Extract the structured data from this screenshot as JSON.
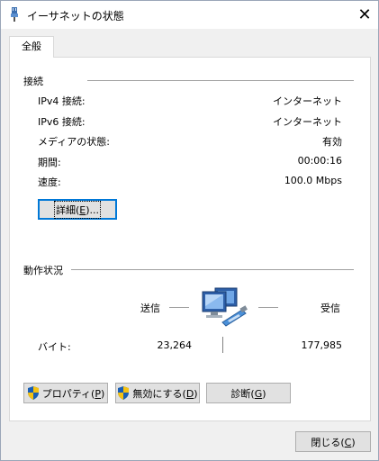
{
  "window": {
    "title": "イーサネットの状態",
    "close_symbol": "✕"
  },
  "tabs": [
    {
      "label": "全般"
    }
  ],
  "connection": {
    "section_title": "接続",
    "rows": [
      {
        "label": "IPv4 接続:",
        "value": "インターネット"
      },
      {
        "label": "IPv6 接続:",
        "value": "インターネット"
      },
      {
        "label": "メディアの状態:",
        "value": "有効"
      },
      {
        "label": "期間:",
        "value": "00:00:16"
      },
      {
        "label": "速度:",
        "value": "100.0 Mbps"
      }
    ],
    "details_button": {
      "text": "詳細(",
      "key": "E",
      "suffix": ")..."
    }
  },
  "activity": {
    "section_title": "動作状況",
    "sent_label": "送信",
    "received_label": "受信",
    "bytes_label": "バイト:",
    "sent_value": "23,264",
    "received_value": "177,985"
  },
  "buttons": {
    "properties": {
      "text": "プロパティ(",
      "key": "P",
      "suffix": ")"
    },
    "disable": {
      "text": "無効にする(",
      "key": "D",
      "suffix": ")"
    },
    "diagnose": {
      "text": "診断(",
      "key": "G",
      "suffix": ")"
    },
    "close": {
      "text": "閉じる(",
      "key": "C",
      "suffix": ")"
    }
  },
  "colors": {
    "accent": "#0078d7",
    "shield_blue": "#1a5fb4",
    "shield_yellow": "#f5c211"
  }
}
